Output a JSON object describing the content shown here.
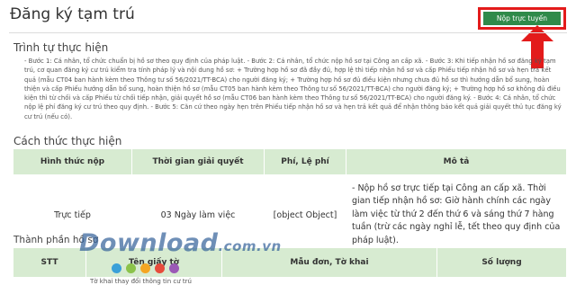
{
  "header": {
    "title": "Đăng ký tạm trú",
    "submit_label": "Nộp trực tuyến"
  },
  "procedure": {
    "title": "Trình tự thực hiện",
    "steps_text": "- Bước 1: Cá nhân, tổ chức chuẩn bị hồ sơ theo quy định của pháp luật. - Bước 2: Cá nhân, tổ chức nộp hồ sơ tại Công an cấp xã. - Bước 3: Khi tiếp nhận hồ sơ đăng ký tạm trú, cơ quan đăng ký cư trú kiểm tra tính pháp lý và nội dung hồ sơ: + Trường hợp hồ sơ đã đầy đủ, hợp lệ thì tiếp nhận hồ sơ và cấp Phiếu tiếp nhận hồ sơ và hẹn trả kết quả (mẫu CT04 ban hành kèm theo Thông tư số 56/2021/TT-BCA) cho người đăng ký; + Trường hợp hồ sơ đủ điều kiện nhưng chưa đủ hồ sơ thì hướng dẫn bổ sung, hoàn thiện và cấp Phiếu hướng dẫn bổ sung, hoàn thiện hồ sơ (mẫu CT05 ban hành kèm theo Thông tư số 56/2021/TT-BCA) cho người đăng ký; + Trường hợp hồ sơ không đủ điều kiện thì từ chối và cấp Phiếu từ chối tiếp nhận, giải quyết hồ sơ (mẫu CT06 ban hành kèm theo Thông tư số 56/2021/TT-BCA) cho người đăng ký. - Bước 4: Cá nhân, tổ chức nộp lệ phí đăng ký cư trú theo quy định. - Bước 5: Căn cứ theo ngày hẹn trên Phiếu tiếp nhận hồ sơ và hẹn trả kết quả để nhận thông báo kết quả giải quyết thủ tục đăng ký cư trú (nếu có)."
  },
  "methods": {
    "title": "Cách thức thực hiện",
    "columns": [
      "Hình thức nộp",
      "Thời gian giải quyết",
      "Phí, Lệ phí",
      "Mô tả"
    ],
    "rows": [
      {
        "form": "Trực tiếp",
        "time": "03 Ngày làm việc",
        "fee": "[object Object]",
        "description": "- Nộp hồ sơ trực tiếp tại Công an cấp xã. Thời gian tiếp nhận hồ sơ: Giờ hành chính các ngày làm việc từ thứ 2 đến thứ 6 và sáng thứ 7 hàng tuần (trừ các ngày nghỉ lễ, tết theo quy định của pháp luật)."
      }
    ]
  },
  "documents": {
    "title": "Thành phần hồ sơ",
    "columns": [
      "STT",
      "Tên giấy tờ",
      "Mẫu đơn, Tờ khai",
      "Số lượng"
    ],
    "next_row_partial": "Tờ khai thay đổi thông tin cư trú"
  },
  "watermark": {
    "text": "Download",
    "suffix": ".com.vn",
    "dot_colors": [
      "#3aa0d8",
      "#8bc34a",
      "#f5a623",
      "#e74c3c",
      "#9b59b6"
    ]
  },
  "colors": {
    "accent_green": "#2f8a4a",
    "header_bg": "#d7ebd1",
    "highlight_red": "#e31b1b"
  }
}
